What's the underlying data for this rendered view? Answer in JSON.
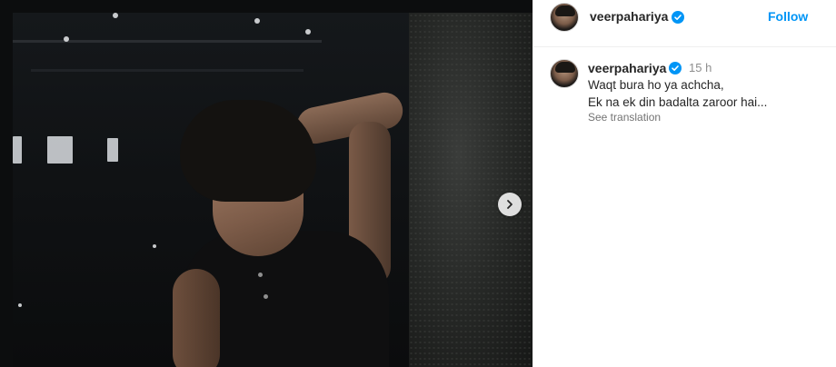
{
  "post": {
    "author": {
      "username": "veerpahariya",
      "verified": true,
      "follow_label": "Follow"
    },
    "caption": {
      "username": "veerpahariya",
      "time_ago": "15 h",
      "line1": "Waqt bura ho ya achcha,",
      "line2": "Ek na ek din badalta zaroor hai...",
      "see_translation": "See translation"
    },
    "media": {
      "icon": "chevron-right-icon"
    }
  },
  "colors": {
    "accent": "#0095f6",
    "verified": "#0095f6",
    "muted": "#8e8e8e"
  }
}
